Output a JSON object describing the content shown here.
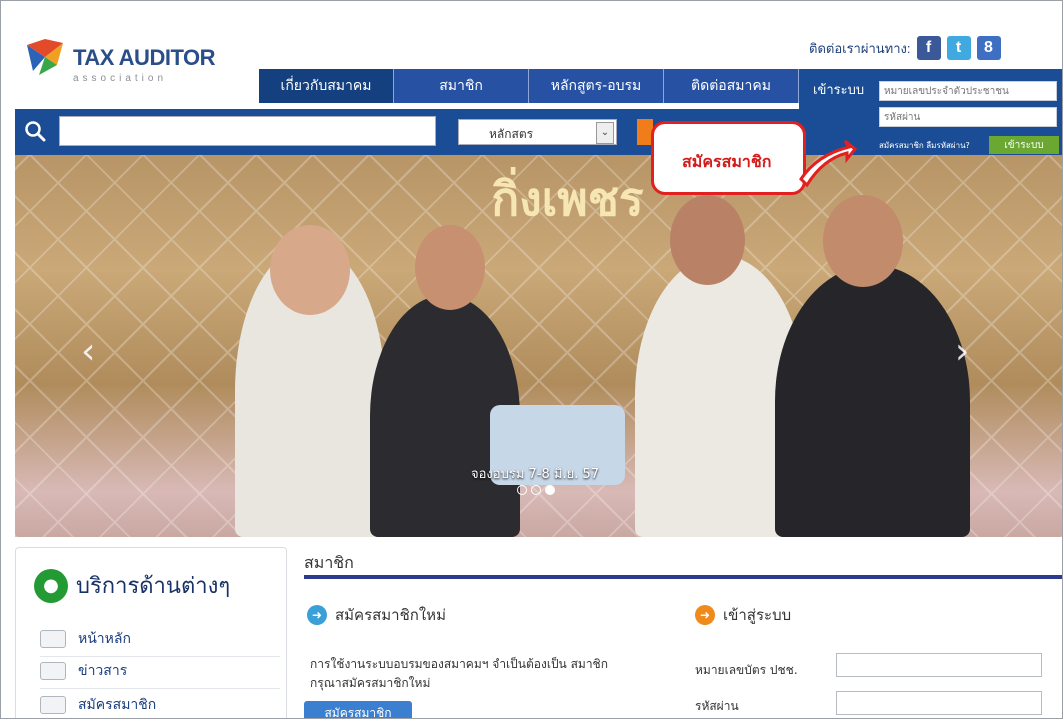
{
  "brand": {
    "name": "TAX AUDITOR",
    "sub": "association"
  },
  "contact": {
    "label": "ติดต่อเราผ่านทาง:",
    "icons": [
      "facebook-icon",
      "twitter-icon",
      "googleplus-icon"
    ],
    "fb": "f",
    "tw": "t",
    "gp": "8"
  },
  "nav": [
    {
      "label": "เกี่ยวกับสมาคม"
    },
    {
      "label": "สมาชิก"
    },
    {
      "label": "หลักสูตร-อบรม"
    },
    {
      "label": "ติดต่อสมาคม"
    }
  ],
  "login": {
    "title": "เข้าระบบ",
    "id_placeholder": "หมายเลขประจำตัวประชาชน",
    "pw_placeholder": "รหัสผ่าน",
    "links": "สมัครสมาชิก ลืมรหัสผ่าน?",
    "button": "เข้าระบบ"
  },
  "search": {
    "select_value": "หลักสตร"
  },
  "callout": "สมัครสมาชิก",
  "hero": {
    "sign": "กิ่งเพชร",
    "caption": "จองอบรม 7-8 มิ.ย. 57",
    "slides": 3,
    "active": 3
  },
  "services": {
    "title": "บริการด้านต่างๆ",
    "items": [
      "หน้าหลัก",
      "ข่าวสาร",
      "สมัครสมาชิก"
    ]
  },
  "content": {
    "title": "สมาชิก",
    "new_member": "สมัครสมาชิกใหม่",
    "login_head": "เข้าสู่ระบบ",
    "desc": "การใช้งานระบบอบรมของสมาคมฯ จำเป็นต้องเป็น สมาชิก กรุณาสมัครสมาชิกใหม่",
    "register_btn": "สมัครสมาชิก",
    "id_label": "หมายเลขบัตร ปชช.",
    "pw_label": "รหัสผ่าน"
  },
  "colors": {
    "primary": "#1a4d95",
    "accent": "#f07d1a",
    "green": "#249a35",
    "callout": "#e32020"
  }
}
